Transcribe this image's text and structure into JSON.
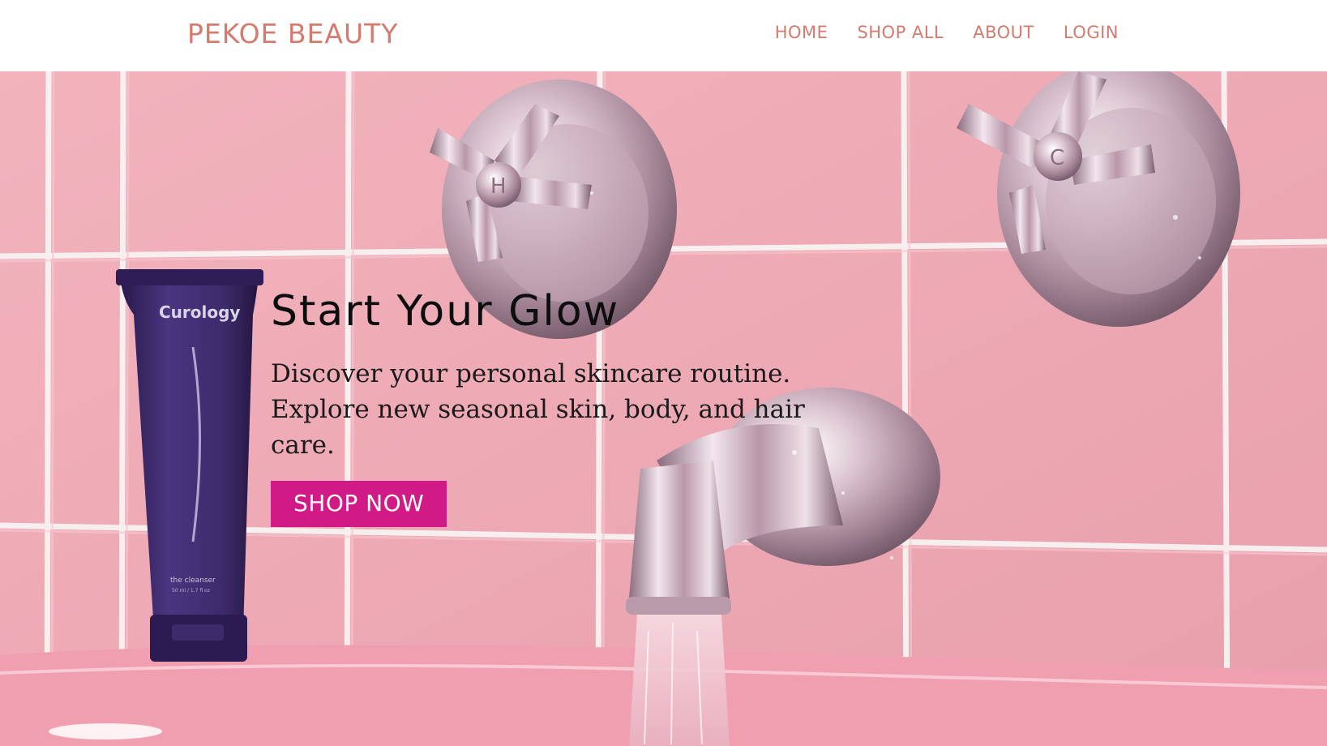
{
  "brand": {
    "name": "PEKOE BEAUTY",
    "color": "#d57a6e"
  },
  "nav": {
    "items": [
      {
        "label": "HOME"
      },
      {
        "label": "SHOP ALL"
      },
      {
        "label": "ABOUT"
      },
      {
        "label": "LOGIN"
      }
    ]
  },
  "hero": {
    "title": "Start Your Glow",
    "subtitle": "Discover your personal skincare routine. Explore new seasonal skin, body, and hair care.",
    "cta_label": "SHOP NOW",
    "cta_color": "#d11a86",
    "tile_color": "#eeaab4",
    "product_brand": "Curology",
    "product_name": "the cleanser",
    "product_size": "50 ml / 1.7 fl oz",
    "faucet_left_letter": "H",
    "faucet_right_letter": "C"
  }
}
